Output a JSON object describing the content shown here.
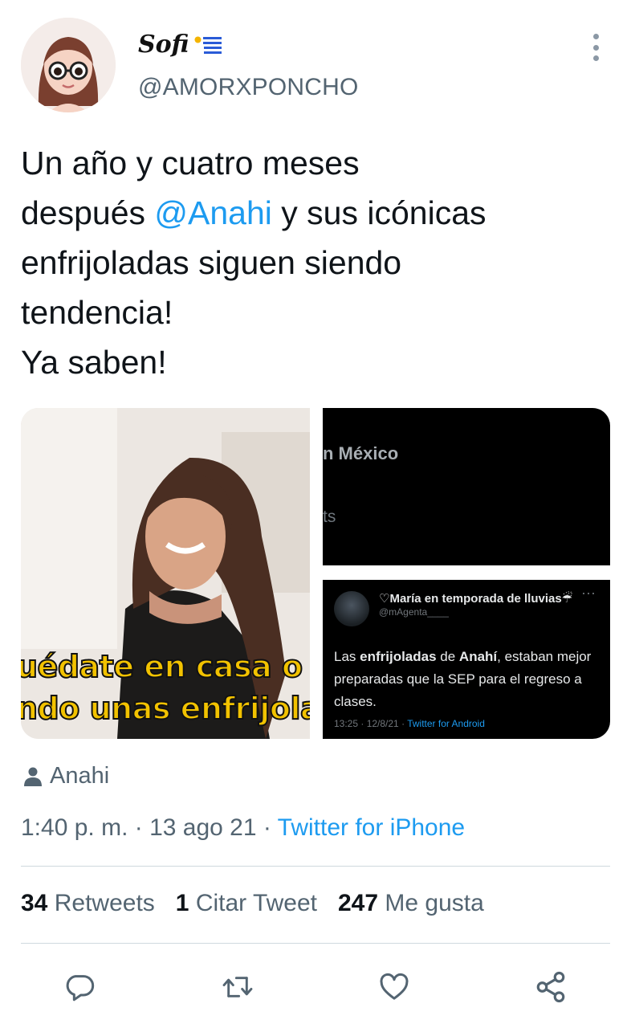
{
  "author": {
    "display_name": "Sofi",
    "handle": "@AMORXPONCHO",
    "flag_icon": "uruguay-flag-icon"
  },
  "tweet": {
    "lines": [
      {
        "before": "Un año y cuatro meses"
      },
      {
        "before": "después ",
        "mention": "@Anahi",
        "after": " y sus icónicas"
      },
      {
        "before": "enfrijoladas siguen siendo"
      },
      {
        "before": "tendencia!"
      },
      {
        "before": "Ya saben!"
      }
    ]
  },
  "media": {
    "meme_caption_1": "uédate en casa o",
    "meme_caption_2": "ndo unas enfrijola",
    "top_right_text_1": "n México",
    "top_right_text_2": "ts",
    "quoted": {
      "name": "♡María en temporada de lluvias☔",
      "handle": "@mAgenta____",
      "dots": "···",
      "body": {
        "p1": "Las ",
        "b1": "enfrijoladas",
        "p2": " de ",
        "b2": "Anahí",
        "p3": ", estaban mejor preparadas que la SEP para el regreso a clases."
      },
      "time": "13:25 · 12/8/21 · ",
      "source": "Twitter for Android"
    }
  },
  "tagged": {
    "icon": "person-icon",
    "name": "Anahi"
  },
  "meta": {
    "time": "1:40 p. m.",
    "sep1": " · ",
    "date": "13 ago 21",
    "sep2": " · ",
    "source": "Twitter for iPhone"
  },
  "stats": {
    "retweets_count": "34",
    "retweets_label": "Retweets",
    "quotes_count": "1",
    "quotes_label": "Citar Tweet",
    "likes_count": "247",
    "likes_label": "Me gusta"
  },
  "actions": {
    "reply_icon": "reply-icon",
    "retweet_icon": "retweet-icon",
    "like_icon": "heart-icon",
    "share_icon": "share-icon"
  },
  "colors": {
    "link": "#1d9bf0",
    "secondary_text": "#536471",
    "primary_text": "#0f1419",
    "divider": "#cfd9de"
  }
}
